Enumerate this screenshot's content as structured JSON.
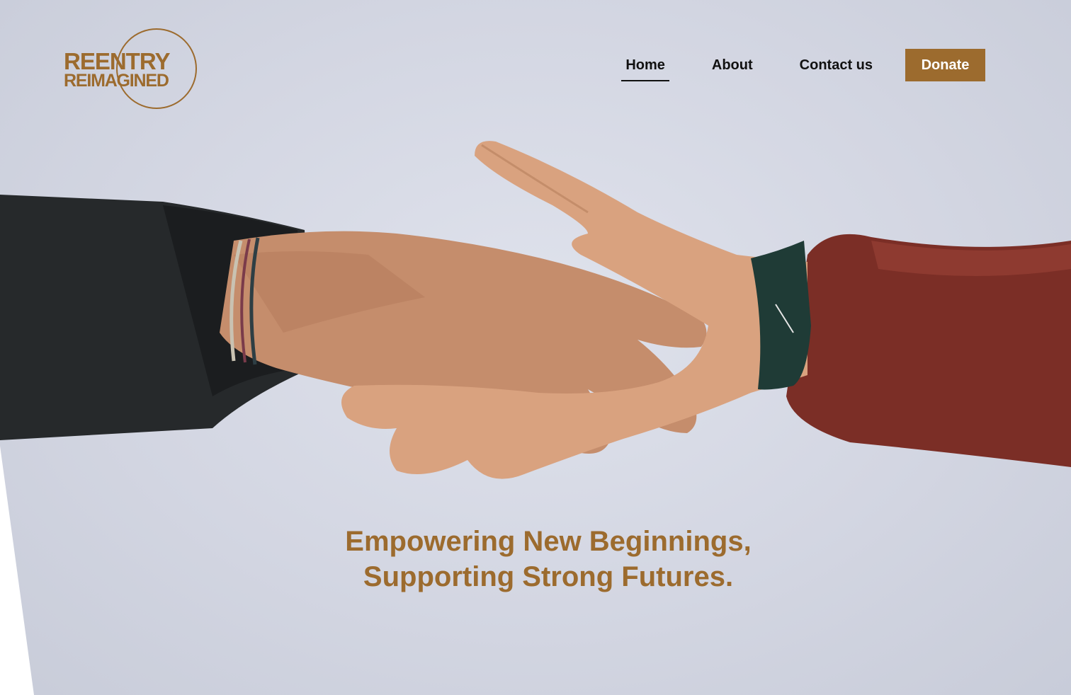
{
  "brand": {
    "line1": "REENTRY",
    "line2": "REIMAGINED",
    "color": "#9c6b2e"
  },
  "nav": {
    "items": [
      {
        "label": "Home",
        "active": true
      },
      {
        "label": "About",
        "active": false
      },
      {
        "label": "Contact us",
        "active": false
      }
    ],
    "donate_label": "Donate"
  },
  "hero": {
    "headline_line1": "Empowering New Beginnings,",
    "headline_line2": "Supporting Strong Futures.",
    "image": "two-hands-reaching-photo"
  },
  "colors": {
    "accent": "#9c6b2e",
    "hero_bg": "#d3d6e2",
    "nav_text": "#111111"
  }
}
